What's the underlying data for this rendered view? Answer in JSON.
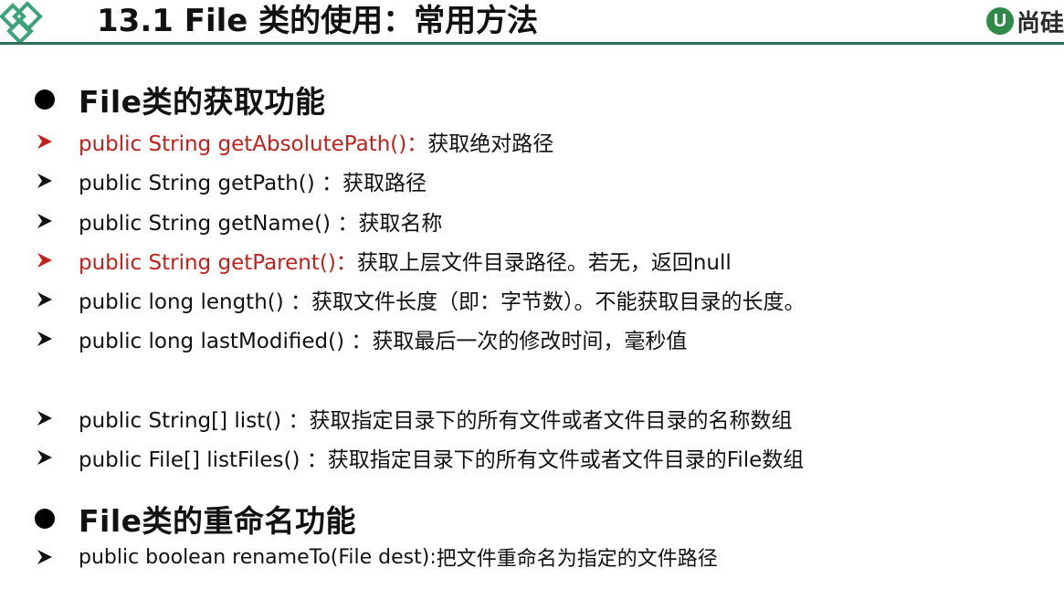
{
  "header": {
    "title": "13.1 File 类的使用：常用方法",
    "brand_badge": "U",
    "brand_text": "尚硅",
    "colors": {
      "rule": "#2f6f5e",
      "brand": "#2f8a4a",
      "highlight": "#c0211c"
    }
  },
  "sections": [
    {
      "heading": "File类的获取功能",
      "items": [
        {
          "method": "public String getAbsolutePath()：",
          "desc": "获取绝对路径",
          "highlight": true
        },
        {
          "method": "public String getPath() ：",
          "desc": "获取路径",
          "highlight": false
        },
        {
          "method": "public String getName() ：",
          "desc": "获取名称",
          "highlight": false
        },
        {
          "method": "public String getParent()：",
          "desc": "获取上层文件目录路径。若无，返回null",
          "highlight": true
        },
        {
          "method": "public long length() ：",
          "desc": "获取文件长度（即：字节数）。不能获取目录的长度。",
          "highlight": false
        },
        {
          "method": "public long lastModified() ：",
          "desc": "获取最后一次的修改时间，毫秒值",
          "highlight": false
        },
        {
          "method": "public String[] list() ：",
          "desc": "获取指定目录下的所有文件或者文件目录的名称数组",
          "highlight": false
        },
        {
          "method": "public File[] listFiles() ：",
          "desc": "获取指定目录下的所有文件或者文件目录的File数组",
          "highlight": false
        }
      ]
    },
    {
      "heading": "File类的重命名功能",
      "items": [
        {
          "method": "public boolean renameTo(File dest):",
          "desc": "把文件重命名为指定的文件路径",
          "highlight": false
        }
      ]
    }
  ]
}
